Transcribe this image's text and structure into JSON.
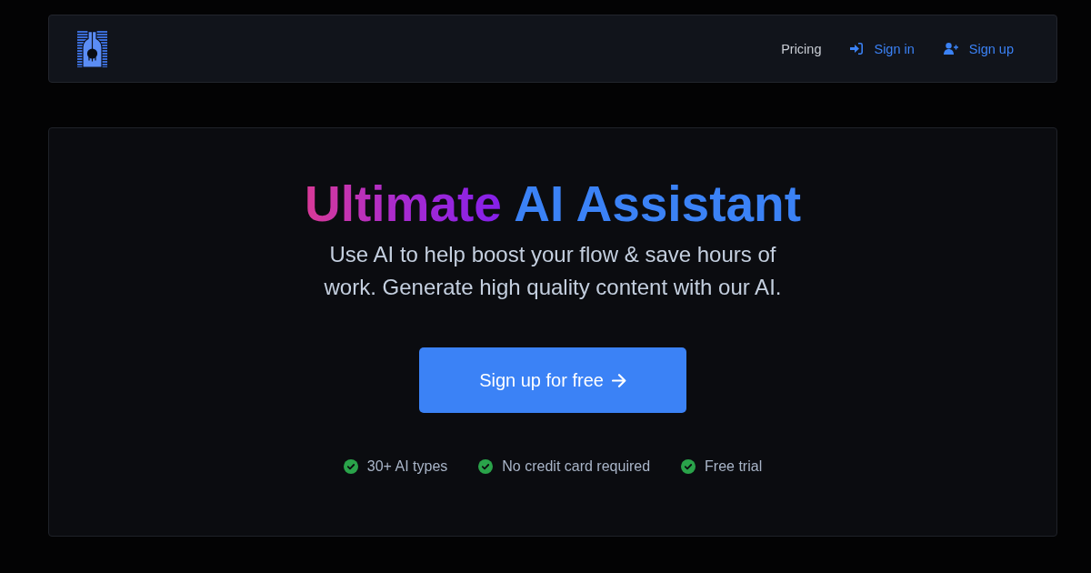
{
  "navbar": {
    "links": [
      {
        "label": "Pricing",
        "kind": "plain"
      },
      {
        "label": "Sign in",
        "kind": "sign-in"
      },
      {
        "label": "Sign up",
        "kind": "sign-up"
      }
    ]
  },
  "hero": {
    "title": {
      "highlight": "Ultimate",
      "rest": "AI Assistant"
    },
    "subtitle": "Use AI to help boost your flow & save hours of work. Generate high quality content with our AI.",
    "cta": {
      "label": "Sign up for free"
    },
    "features": [
      {
        "label": "30+ AI types"
      },
      {
        "label": "No credit card required"
      },
      {
        "label": "Free trial"
      }
    ]
  }
}
